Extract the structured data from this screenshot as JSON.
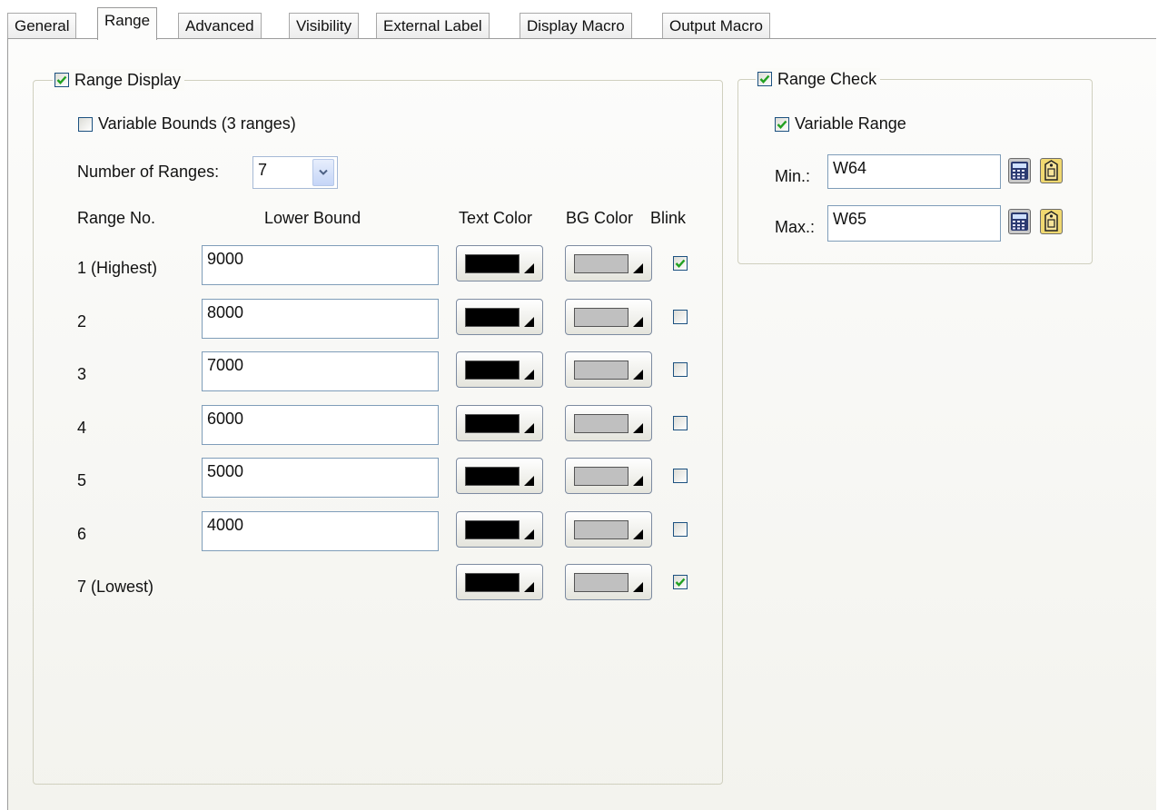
{
  "tabs": [
    "General",
    "Range",
    "Advanced",
    "Visibility",
    "External Label",
    "Display Macro",
    "Output Macro"
  ],
  "active_tab": "Range",
  "range_display": {
    "label": "Range Display",
    "checked": true,
    "variable_bounds": {
      "label": "Variable Bounds (3 ranges)",
      "checked": false
    },
    "number_of_ranges": {
      "label": "Number of Ranges:",
      "value": "7"
    },
    "headers": {
      "range_no": "Range No.",
      "lower_bound": "Lower Bound",
      "text_color": "Text Color",
      "bg_color": "BG Color",
      "blink": "Blink"
    },
    "rows": [
      {
        "name": "1 (Highest)",
        "lower_bound": "9000",
        "blink": true
      },
      {
        "name": "2",
        "lower_bound": "8000",
        "blink": false
      },
      {
        "name": "3",
        "lower_bound": "7000",
        "blink": false
      },
      {
        "name": "4",
        "lower_bound": "6000",
        "blink": false
      },
      {
        "name": "5",
        "lower_bound": "5000",
        "blink": false
      },
      {
        "name": "6",
        "lower_bound": "4000",
        "blink": false
      },
      {
        "name": "7 (Lowest)",
        "lower_bound": null,
        "blink": true
      }
    ],
    "text_color": "#000000",
    "bg_color": "#c0c0c0"
  },
  "range_check": {
    "label": "Range Check",
    "checked": true,
    "variable_range": {
      "label": "Variable Range",
      "checked": true
    },
    "min": {
      "label": "Min.:",
      "value": "W64"
    },
    "max": {
      "label": "Max.:",
      "value": "W65"
    },
    "calculator_icon": "calculator-icon",
    "address_icon": "tag-icon"
  },
  "colors": {
    "check_mark": "#21a121",
    "control_border": "#7f9db9",
    "group_border": "#d0d0bf"
  }
}
